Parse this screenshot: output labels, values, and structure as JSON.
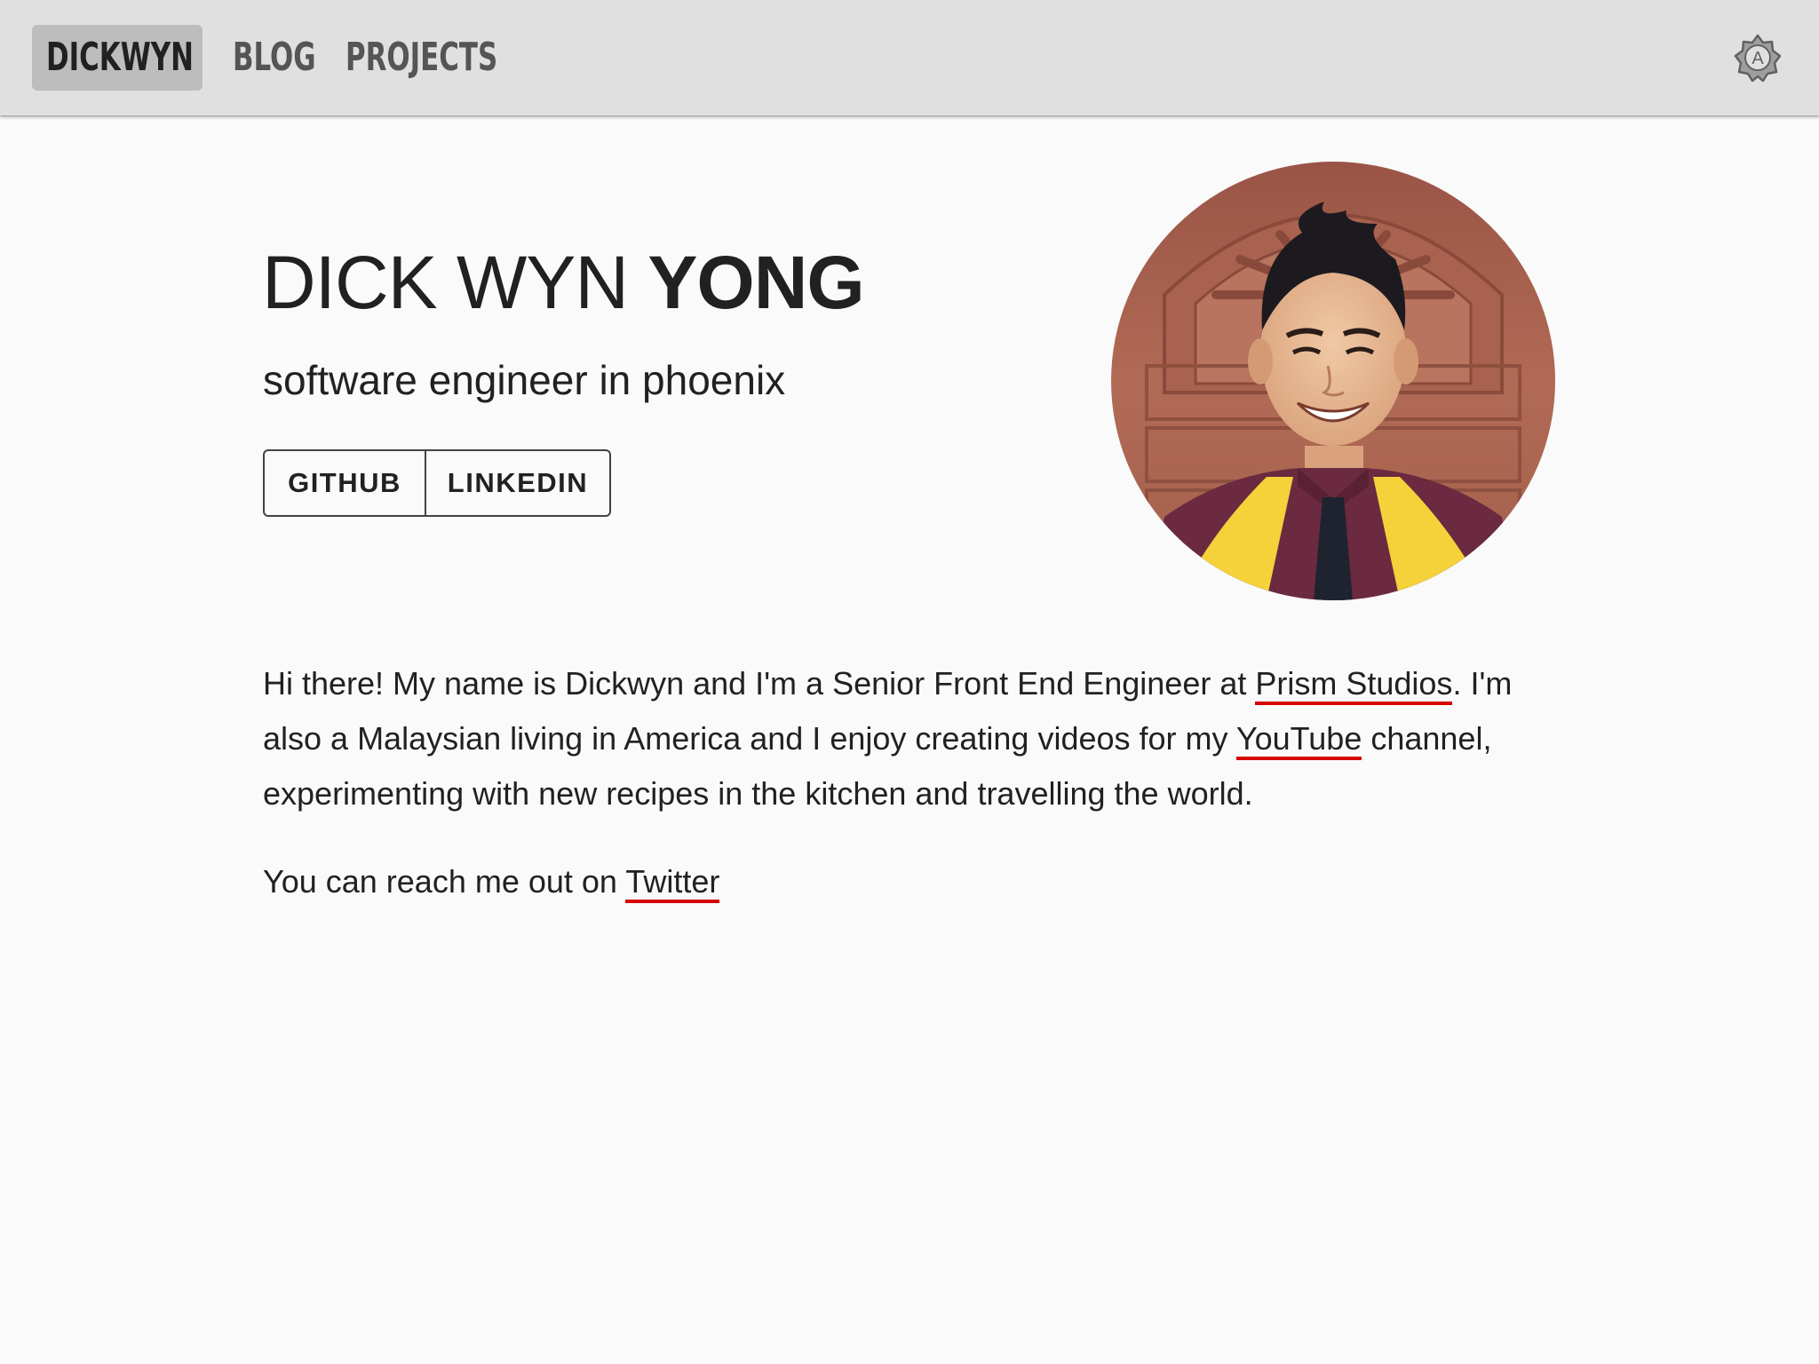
{
  "nav": {
    "brand": "DICKWYN",
    "links": [
      "BLOG",
      "PROJECTS"
    ],
    "theme_toggle_icon": "auto-theme-icon"
  },
  "hero": {
    "first_name": "DICK WYN",
    "last_name": "YONG",
    "subtitle": "software engineer in phoenix",
    "buttons": [
      "GITHUB",
      "LINKEDIN"
    ],
    "avatar": "profile-photo"
  },
  "bio": {
    "p1_before_prism": "Hi there! My name is Dickwyn and I'm a Senior Front End Engineer at ",
    "prism_link": "Prism Studios",
    "p1_between": ". I'm also a Malaysian living in America and I enjoy creating videos for my ",
    "youtube_link": "YouTube",
    "p1_after": " channel, experimenting with new recipes in the kitchen and travelling the world.",
    "p2_before": "You can reach me out on ",
    "twitter_link": "Twitter"
  },
  "colors": {
    "topbar": "#e0e0e0",
    "background": "#fafafa",
    "link_underline": "#d50000",
    "text": "#212121"
  }
}
